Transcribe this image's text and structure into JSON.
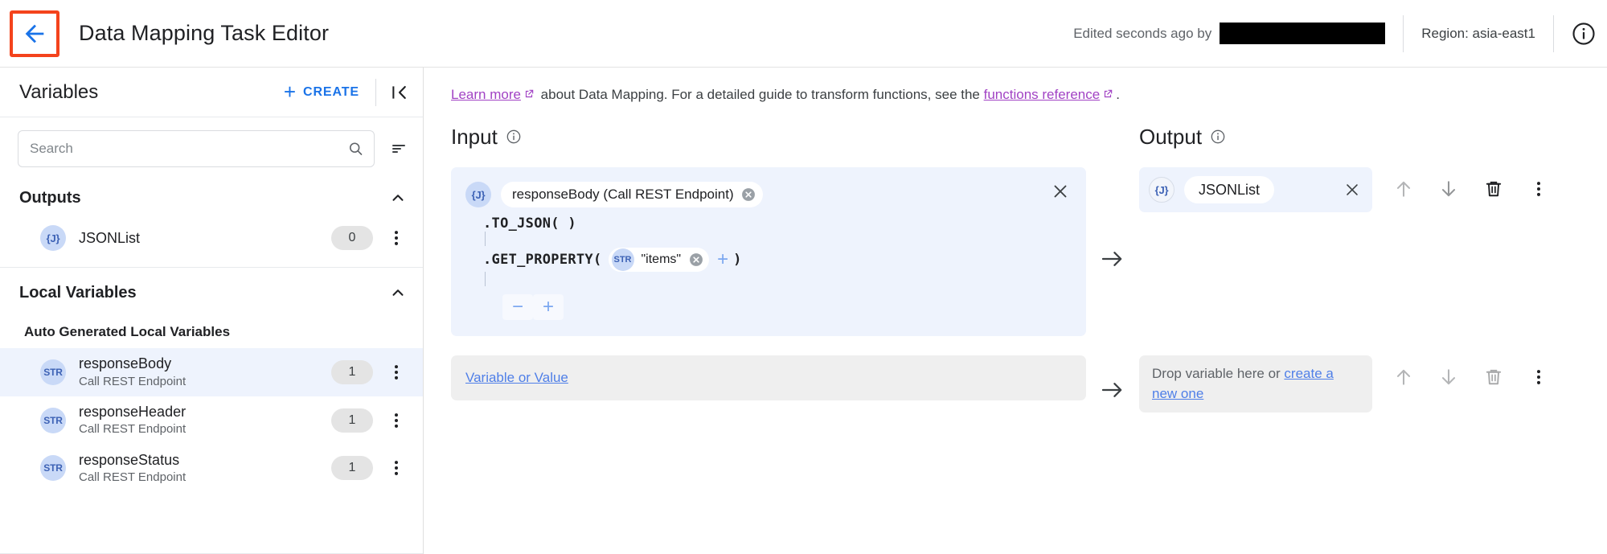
{
  "header": {
    "back_icon": "arrow-left-icon",
    "title": "Data Mapping Task Editor",
    "edited_text": "Edited seconds ago by",
    "edited_user": "",
    "region": "Region: asia-east1",
    "info_icon": "info-icon"
  },
  "sidebar": {
    "title": "Variables",
    "create_label": "CREATE",
    "collapse_icon": "collapse-panel-icon",
    "search": {
      "placeholder": "Search",
      "value": "",
      "icon": "search-icon",
      "filter_icon": "filter-list-icon"
    },
    "sections": [
      {
        "title": "Outputs",
        "chevron": "chevron-up-icon",
        "items": [
          {
            "badge": "{J}",
            "name": "JSONList",
            "sub": "",
            "count": "0"
          }
        ]
      },
      {
        "title": "Local Variables",
        "chevron": "chevron-up-icon",
        "subsection_label": "Auto Generated Local Variables",
        "items": [
          {
            "badge": "STR",
            "name": "responseBody",
            "sub": "Call REST Endpoint",
            "count": "1",
            "selected": true
          },
          {
            "badge": "STR",
            "name": "responseHeader",
            "sub": "Call REST Endpoint",
            "count": "1",
            "selected": false
          },
          {
            "badge": "STR",
            "name": "responseStatus",
            "sub": "Call REST Endpoint",
            "count": "1",
            "selected": false
          }
        ]
      }
    ]
  },
  "main": {
    "banner": {
      "link1": "Learn more",
      "text1": " about Data Mapping. For a detailed guide to transform functions, see the ",
      "link2": "functions reference",
      "text2": "."
    },
    "input_heading": "Input",
    "output_heading": "Output",
    "rows": [
      {
        "input": {
          "badge": "{J}",
          "chip": "responseBody (Call REST Endpoint)",
          "lines": [
            {
              "fn": ".TO_JSON( )"
            },
            {
              "fn": ".GET_PROPERTY(",
              "arg_badge": "STR",
              "arg_value": "\"items\"",
              "close": ")"
            }
          ],
          "minus_label": "−",
          "plus_label": "+",
          "close_icon": "close-icon"
        },
        "arrow_icon": "arrow-right-icon",
        "output": {
          "badge": "{J}",
          "chip": "JSONList",
          "close_icon": "close-icon"
        },
        "actions": [
          "arrow-up-icon",
          "arrow-down-icon",
          "trash-icon",
          "more-vert-icon"
        ]
      },
      {
        "input": {
          "link": "Variable or Value"
        },
        "arrow_icon": "arrow-right-icon",
        "output": {
          "text_before": "Drop variable here or ",
          "link": "create a new one"
        },
        "actions": [
          "arrow-up-icon",
          "arrow-down-icon",
          "trash-icon",
          "more-vert-icon"
        ]
      }
    ]
  },
  "colors": {
    "accent_blue": "#1a73e8",
    "link_blue": "#4f7fe8",
    "visited_purple": "#a142c4",
    "panel_blue": "#eef3fd",
    "badge_blue": "#c9d9f7",
    "highlight_red": "#f4431c"
  }
}
